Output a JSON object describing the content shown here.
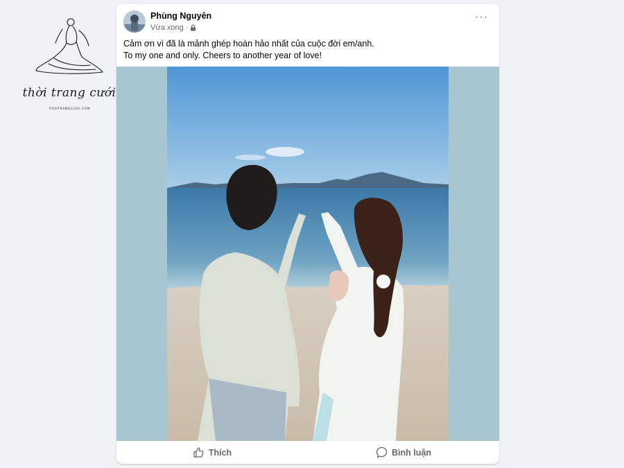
{
  "watermark": {
    "brand": "thời trang cưới",
    "site": "THOITRANGCUOI.COM"
  },
  "post": {
    "author": "Phùng Nguyên",
    "time": "Vừa xong",
    "separator": "·",
    "privacy_icon": "lock-icon",
    "caption_line1": "Cảm ơn vì đã là mảnh ghép hoàn hảo nhất của cuộc đời em/anh.",
    "caption_line2": "To my one and only. Cheers to another year of love!",
    "more_label": "···"
  },
  "actions": {
    "like_label": "Thích",
    "like_icon": "thumbs-up-icon",
    "comment_label": "Bình luận",
    "comment_icon": "comment-bubble-icon"
  },
  "colors": {
    "page_bg": "#f0f2f5",
    "photo_side_bg": "#a8c6d0",
    "text_secondary": "#65676b"
  }
}
